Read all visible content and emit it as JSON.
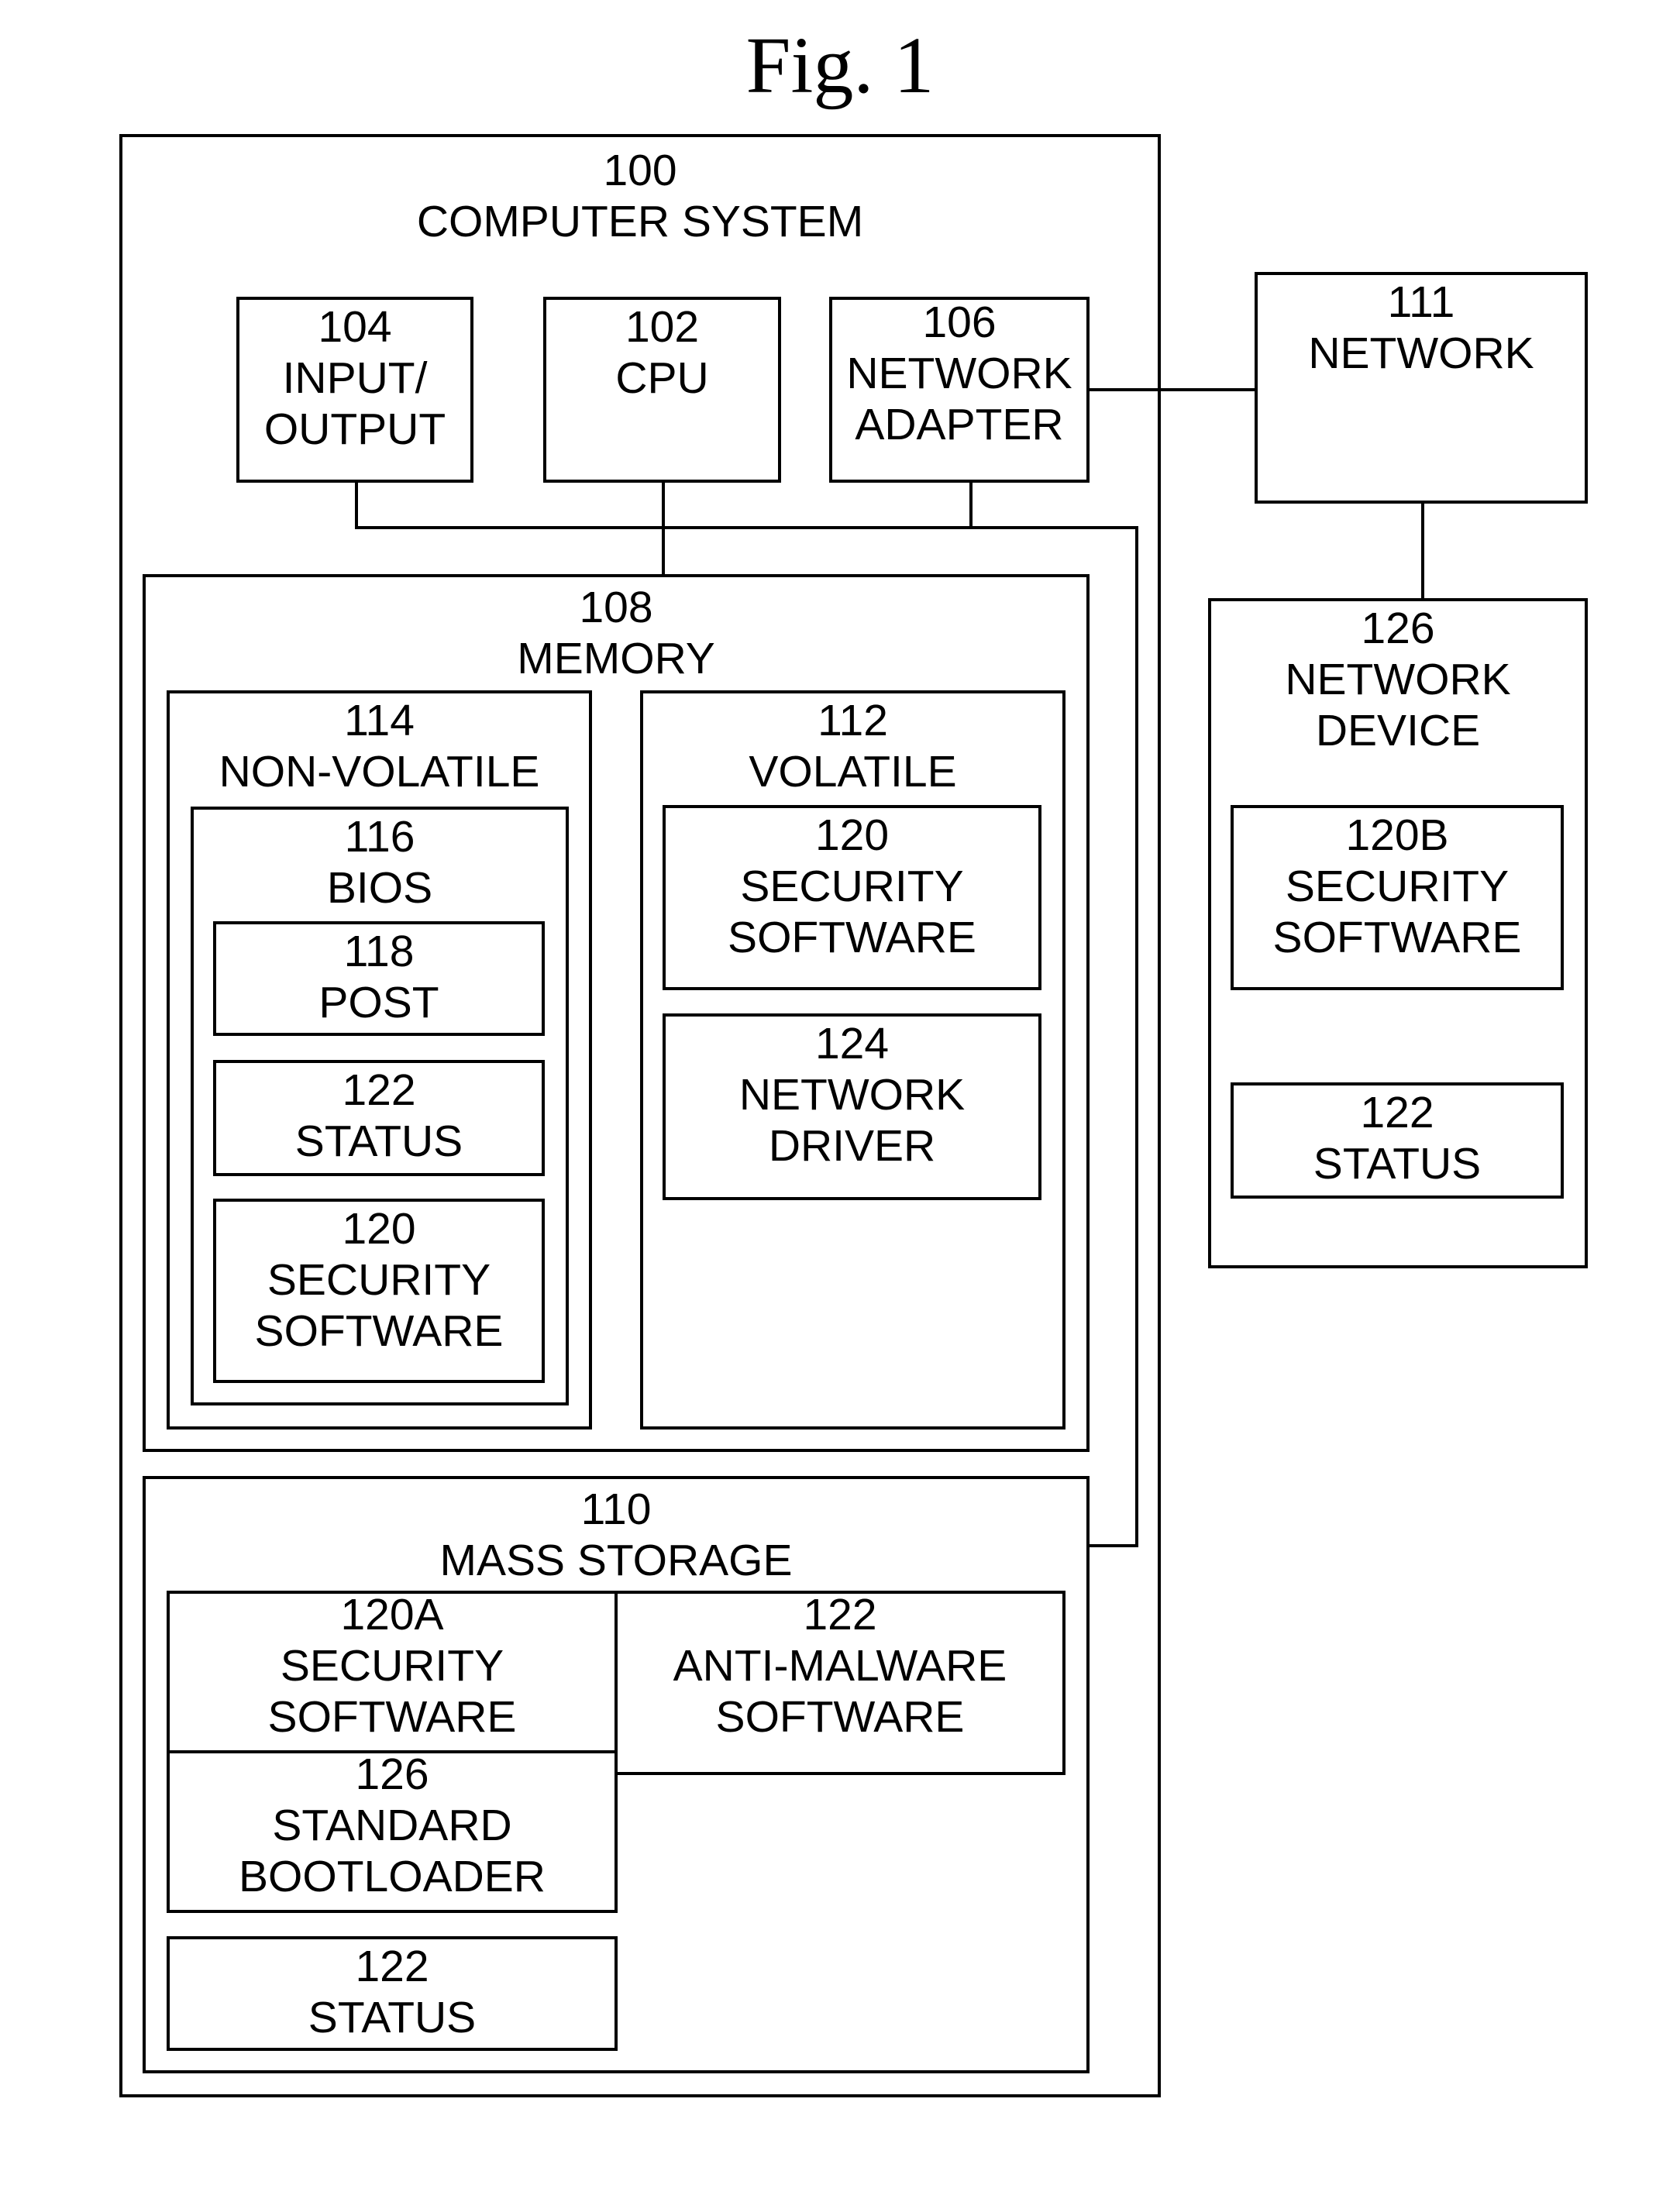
{
  "figure": {
    "title": "Fig. 1"
  },
  "computer_system": {
    "number": "100",
    "name": "COMPUTER SYSTEM",
    "io": {
      "number": "104",
      "line1": "INPUT/",
      "line2": "OUTPUT"
    },
    "cpu": {
      "number": "102",
      "line1": "CPU"
    },
    "network_adapter": {
      "number": "106",
      "line1": "NETWORK",
      "line2": "ADAPTER"
    },
    "memory": {
      "number": "108",
      "name": "MEMORY",
      "non_volatile": {
        "number": "114",
        "name": "NON-VOLATILE",
        "bios": {
          "number": "116",
          "name": "BIOS",
          "post": {
            "number": "118",
            "name": "POST"
          },
          "status": {
            "number": "122",
            "name": "STATUS"
          },
          "security_software": {
            "number": "120",
            "line1": "SECURITY",
            "line2": "SOFTWARE"
          }
        }
      },
      "volatile": {
        "number": "112",
        "name": "VOLATILE",
        "security_software": {
          "number": "120",
          "line1": "SECURITY",
          "line2": "SOFTWARE"
        },
        "network_driver": {
          "number": "124",
          "line1": "NETWORK",
          "line2": "DRIVER"
        }
      }
    },
    "mass_storage": {
      "number": "110",
      "name": "MASS STORAGE",
      "security_software": {
        "number": "120A",
        "line1": "SECURITY",
        "line2": "SOFTWARE"
      },
      "anti_malware": {
        "number": "122",
        "line1": "ANTI-MALWARE",
        "line2": "SOFTWARE"
      },
      "bootloader": {
        "number": "126",
        "line1": "STANDARD",
        "line2": "BOOTLOADER"
      },
      "status": {
        "number": "122",
        "name": "STATUS"
      }
    }
  },
  "network": {
    "number": "111",
    "name": "NETWORK"
  },
  "network_device": {
    "number": "126",
    "line1": "NETWORK",
    "line2": "DEVICE",
    "security_software": {
      "number": "120B",
      "line1": "SECURITY",
      "line2": "SOFTWARE"
    },
    "status": {
      "number": "122",
      "name": "STATUS"
    }
  }
}
